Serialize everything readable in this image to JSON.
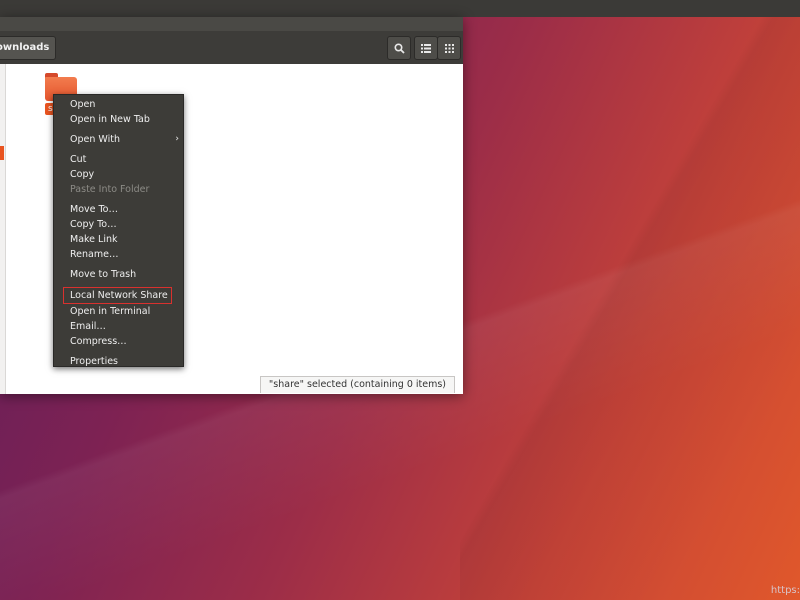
{
  "window": {
    "breadcrumb": "ownloads",
    "status": "\"share\" selected  (containing 0 items)"
  },
  "folder": {
    "label": "s"
  },
  "menu": {
    "open": "Open",
    "open_new_tab": "Open in New Tab",
    "open_with": "Open With",
    "cut": "Cut",
    "copy": "Copy",
    "paste_into": "Paste Into Folder",
    "move_to": "Move To…",
    "copy_to": "Copy To…",
    "make_link": "Make Link",
    "rename": "Rename…",
    "move_trash": "Move to Trash",
    "local_share": "Local Network Share",
    "open_terminal": "Open in Terminal",
    "email": "Email…",
    "compress": "Compress…",
    "properties": "Properties"
  },
  "icons": {
    "search": "search-icon",
    "list_view": "list-view-icon",
    "grid_view": "grid-view-icon",
    "submenu": "chevron-right-icon"
  },
  "colors": {
    "accent": "#e95420",
    "highlight_box": "#d9312e",
    "menu_bg": "#3d3c38"
  },
  "desktop": {
    "url_hint": "https:"
  }
}
